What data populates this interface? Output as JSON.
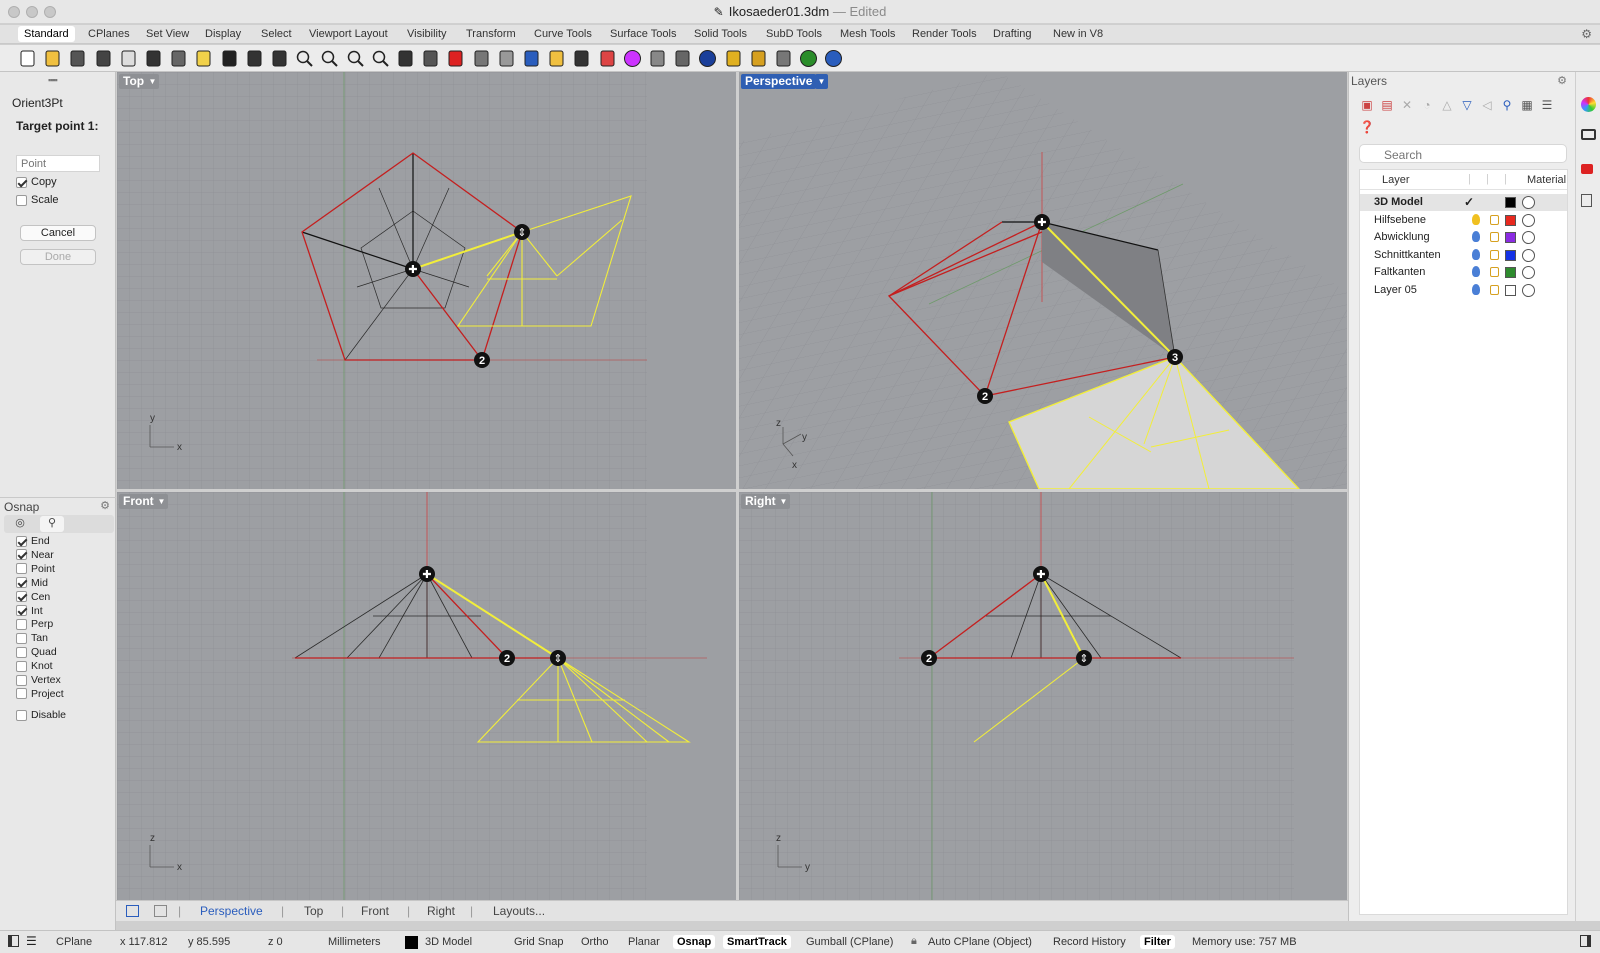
{
  "window": {
    "title": "Ikosaeder01.3dm",
    "separator": "—",
    "status": "Edited"
  },
  "toolbar_tabs": [
    "Standard",
    "CPlanes",
    "Set View",
    "Display",
    "Select",
    "Viewport Layout",
    "Visibility",
    "Transform",
    "Curve Tools",
    "Surface Tools",
    "Solid Tools",
    "SubD Tools",
    "Mesh Tools",
    "Render Tools",
    "Drafting",
    "New in V8"
  ],
  "toolbar_active_tab": "Standard",
  "toolbar_icons": [
    "new-icon",
    "open-icon",
    "save-icon",
    "print-icon",
    "import-icon",
    "cut-icon",
    "copy-icon",
    "paste-icon",
    "undo-icon",
    "pan-hand-icon",
    "rotate-view-icon",
    "zoom-icon",
    "zoom-window-icon",
    "zoom-extents-icon",
    "zoom-selected-icon",
    "undo-view-icon",
    "four-viewports-icon",
    "car-icon",
    "grid-icon",
    "cplane-icon",
    "snap-icon",
    "light-bulb-icon",
    "lock-icon",
    "layer-icon",
    "color-wheel-icon",
    "shade-icon",
    "render-icon",
    "sphere-icon",
    "options-icon",
    "gear-icon",
    "analyze-icon",
    "globe-icon",
    "help-icon"
  ],
  "command": {
    "name": "Orient3Pt",
    "prompt": "Target point 1:",
    "input_placeholder": "Point",
    "options": [
      {
        "label": "Copy",
        "checked": true
      },
      {
        "label": "Scale",
        "checked": false
      }
    ],
    "cancel_label": "Cancel",
    "done_label": "Done"
  },
  "osnap": {
    "title": "Osnap",
    "items": [
      {
        "label": "End",
        "checked": true
      },
      {
        "label": "Near",
        "checked": true
      },
      {
        "label": "Point",
        "checked": false
      },
      {
        "label": "Mid",
        "checked": true
      },
      {
        "label": "Cen",
        "checked": true
      },
      {
        "label": "Int",
        "checked": true
      },
      {
        "label": "Perp",
        "checked": false
      },
      {
        "label": "Tan",
        "checked": false
      },
      {
        "label": "Quad",
        "checked": false
      },
      {
        "label": "Knot",
        "checked": false
      },
      {
        "label": "Vertex",
        "checked": false
      },
      {
        "label": "Project",
        "checked": false
      }
    ],
    "disable_label": "Disable",
    "disable_checked": false
  },
  "viewports": {
    "top": {
      "title": "Top",
      "axis_1": "y",
      "axis_2": "x",
      "marker_2": "2"
    },
    "perspective": {
      "title": "Perspective",
      "axis_1": "z",
      "axis_2": "y",
      "axis_3": "x",
      "marker_2": "2",
      "marker_3": "3"
    },
    "front": {
      "title": "Front",
      "axis_1": "z",
      "axis_2": "x",
      "marker_2": "2"
    },
    "right": {
      "title": "Right",
      "axis_1": "z",
      "axis_2": "y",
      "marker_2": "2"
    }
  },
  "viewport_tabs": {
    "active": "Perspective",
    "others": [
      "Top",
      "Front",
      "Right"
    ],
    "layouts": "Layouts...",
    "separator": "|"
  },
  "layers": {
    "title": "Layers",
    "search_placeholder": "Search",
    "col_layer": "Layer",
    "col_material": "Material",
    "rows": [
      {
        "name": "3D Model",
        "current": true,
        "color": "#000000"
      },
      {
        "name": "Hilfsebene",
        "current": false,
        "color": "#e8281e",
        "bulb": "#f0c020"
      },
      {
        "name": "Abwicklung",
        "current": false,
        "color": "#8a2be2",
        "bulb": "#4a7fd6"
      },
      {
        "name": "Schnittkanten",
        "current": false,
        "color": "#1432e6",
        "bulb": "#4a7fd6"
      },
      {
        "name": "Faltkanten",
        "current": false,
        "color": "#2e8b2e",
        "bulb": "#4a7fd6"
      },
      {
        "name": "Layer 05",
        "current": false,
        "color": "#ffffff",
        "bulb": "#4a7fd6"
      }
    ]
  },
  "status": {
    "cplane": "CPlane",
    "x": "x 117.812",
    "y": "y 85.595",
    "z": "z 0",
    "units": "Millimeters",
    "layer": "3D Model",
    "grid_snap": "Grid Snap",
    "ortho": "Ortho",
    "planar": "Planar",
    "osnap": "Osnap",
    "smarttrack": "SmartTrack",
    "gumball": "Gumball (CPlane)",
    "auto_cplane": "Auto CPlane (Object)",
    "record_history": "Record History",
    "filter": "Filter",
    "memory": "Memory use: 757 MB"
  },
  "colors": {
    "accent": "#2f5fb3",
    "red_edge": "#c41f1f",
    "yellow_edge": "#f2ee3a",
    "viewport_bg": "#9d9fa3"
  }
}
